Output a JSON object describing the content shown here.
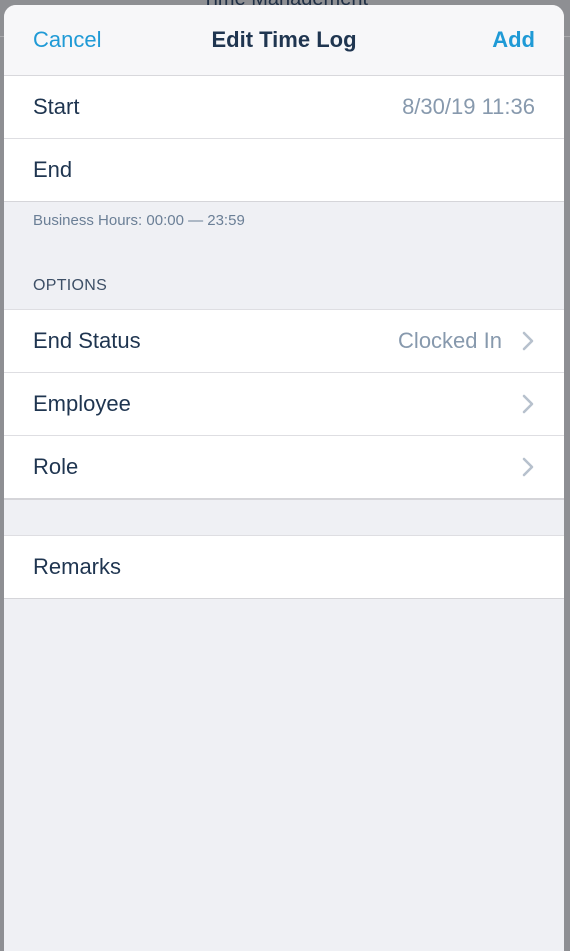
{
  "backdrop": {
    "title": "Time Management"
  },
  "navbar": {
    "cancel_label": "Cancel",
    "title": "Edit Time Log",
    "add_label": "Add"
  },
  "time_rows": [
    {
      "label": "Start",
      "value": "8/30/19 11:36"
    },
    {
      "label": "End",
      "value": ""
    }
  ],
  "business_hours": "Business Hours: 00:00 — 23:59",
  "options": {
    "header": "OPTIONS",
    "rows": [
      {
        "label": "End Status",
        "value": "Clocked In",
        "icon": "chevron-right-icon"
      },
      {
        "label": "Employee",
        "value": "",
        "icon": "chevron-right-icon"
      },
      {
        "label": "Role",
        "value": "",
        "icon": "chevron-right-icon"
      }
    ]
  },
  "remarks": {
    "label": "Remarks"
  },
  "colors": {
    "accent": "#1f9ad6",
    "text": "#1f3550",
    "secondary_text": "#8799ad",
    "grouped_background": "#eff0f4"
  }
}
